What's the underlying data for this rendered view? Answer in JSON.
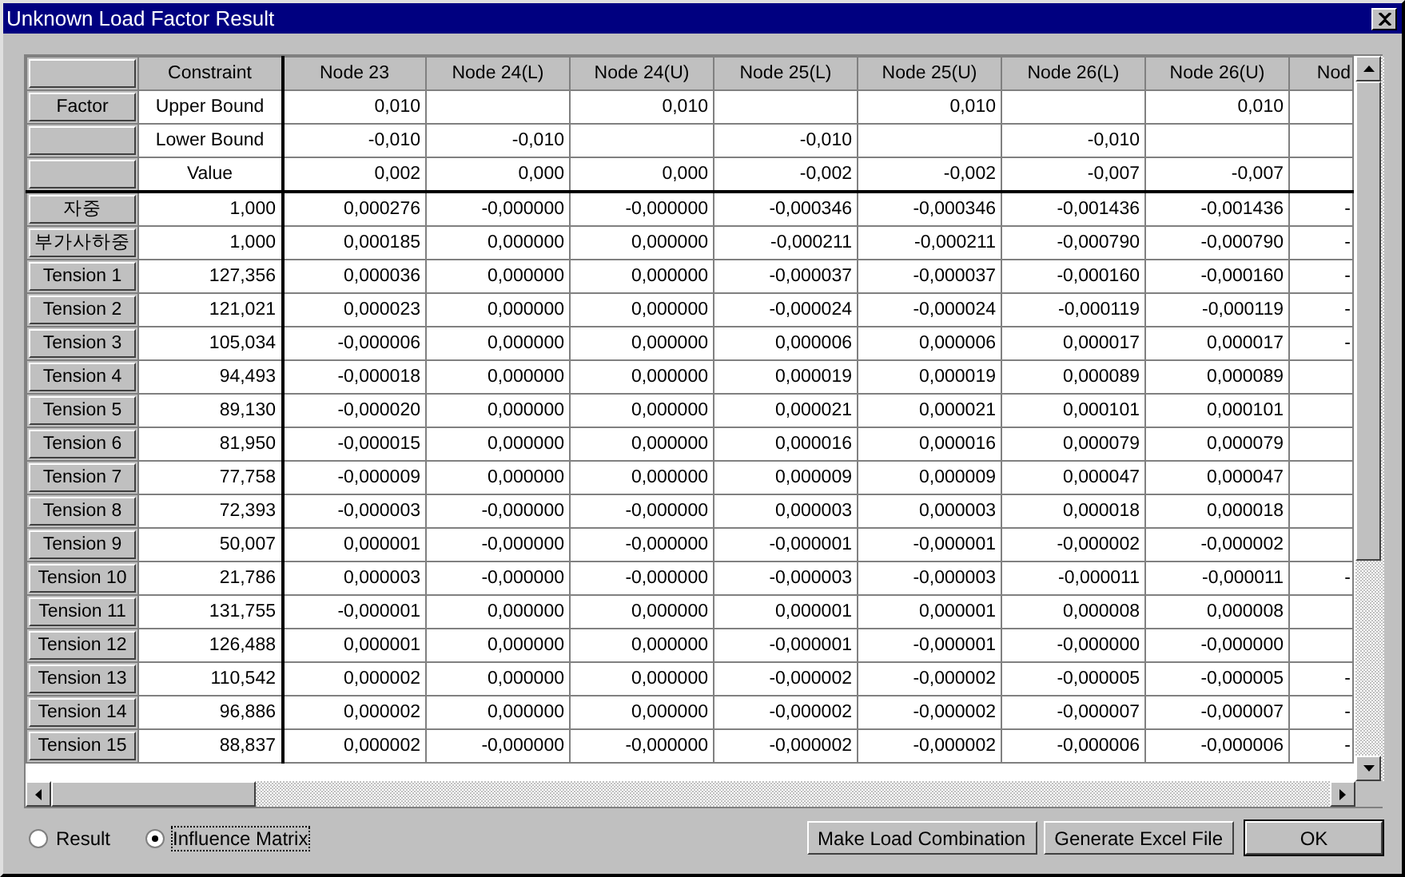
{
  "window": {
    "title": "Unknown Load Factor Result"
  },
  "table": {
    "columns": [
      "Constraint",
      "Node 23",
      "Node 24(L)",
      "Node 24(U)",
      "Node 25(L)",
      "Node 25(U)",
      "Node 26(L)",
      "Node 26(U)",
      "Nod"
    ],
    "factor_rows": [
      {
        "header": "Factor",
        "cells": [
          "Upper Bound",
          "0,010",
          null,
          "0,010",
          null,
          "0,010",
          null,
          "0,010",
          null
        ]
      },
      {
        "header": null,
        "cells": [
          "Lower Bound",
          "-0,010",
          "-0,010",
          null,
          "-0,010",
          null,
          "-0,010",
          null,
          null
        ]
      },
      {
        "header": null,
        "cells": [
          "Value",
          "0,002",
          "0,000",
          "0,000",
          "-0,002",
          "-0,002",
          "-0,007",
          "-0,007",
          null
        ]
      }
    ],
    "rows": [
      {
        "header": "자중",
        "cells": [
          "1,000",
          "0,000276",
          "-0,000000",
          "-0,000000",
          "-0,000346",
          "-0,000346",
          "-0,001436",
          "-0,001436",
          "-"
        ]
      },
      {
        "header": "부가사하중",
        "cells": [
          "1,000",
          "0,000185",
          "0,000000",
          "0,000000",
          "-0,000211",
          "-0,000211",
          "-0,000790",
          "-0,000790",
          "-"
        ]
      },
      {
        "header": "Tension 1",
        "cells": [
          "127,356",
          "0,000036",
          "0,000000",
          "0,000000",
          "-0,000037",
          "-0,000037",
          "-0,000160",
          "-0,000160",
          "-"
        ]
      },
      {
        "header": "Tension 2",
        "cells": [
          "121,021",
          "0,000023",
          "0,000000",
          "0,000000",
          "-0,000024",
          "-0,000024",
          "-0,000119",
          "-0,000119",
          "-"
        ]
      },
      {
        "header": "Tension 3",
        "cells": [
          "105,034",
          "-0,000006",
          "0,000000",
          "0,000000",
          "0,000006",
          "0,000006",
          "0,000017",
          "0,000017",
          "-"
        ]
      },
      {
        "header": "Tension 4",
        "cells": [
          "94,493",
          "-0,000018",
          "0,000000",
          "0,000000",
          "0,000019",
          "0,000019",
          "0,000089",
          "0,000089",
          null
        ]
      },
      {
        "header": "Tension 5",
        "cells": [
          "89,130",
          "-0,000020",
          "0,000000",
          "0,000000",
          "0,000021",
          "0,000021",
          "0,000101",
          "0,000101",
          null
        ]
      },
      {
        "header": "Tension 6",
        "cells": [
          "81,950",
          "-0,000015",
          "0,000000",
          "0,000000",
          "0,000016",
          "0,000016",
          "0,000079",
          "0,000079",
          null
        ]
      },
      {
        "header": "Tension 7",
        "cells": [
          "77,758",
          "-0,000009",
          "0,000000",
          "0,000000",
          "0,000009",
          "0,000009",
          "0,000047",
          "0,000047",
          null
        ]
      },
      {
        "header": "Tension 8",
        "cells": [
          "72,393",
          "-0,000003",
          "-0,000000",
          "-0,000000",
          "0,000003",
          "0,000003",
          "0,000018",
          "0,000018",
          null
        ]
      },
      {
        "header": "Tension 9",
        "cells": [
          "50,007",
          "0,000001",
          "-0,000000",
          "-0,000000",
          "-0,000001",
          "-0,000001",
          "-0,000002",
          "-0,000002",
          null
        ]
      },
      {
        "header": "Tension 10",
        "cells": [
          "21,786",
          "0,000003",
          "-0,000000",
          "-0,000000",
          "-0,000003",
          "-0,000003",
          "-0,000011",
          "-0,000011",
          "-"
        ]
      },
      {
        "header": "Tension 11",
        "cells": [
          "131,755",
          "-0,000001",
          "0,000000",
          "0,000000",
          "0,000001",
          "0,000001",
          "0,000008",
          "0,000008",
          null
        ]
      },
      {
        "header": "Tension 12",
        "cells": [
          "126,488",
          "0,000001",
          "0,000000",
          "0,000000",
          "-0,000001",
          "-0,000001",
          "-0,000000",
          "-0,000000",
          null
        ]
      },
      {
        "header": "Tension 13",
        "cells": [
          "110,542",
          "0,000002",
          "0,000000",
          "0,000000",
          "-0,000002",
          "-0,000002",
          "-0,000005",
          "-0,000005",
          "-"
        ]
      },
      {
        "header": "Tension 14",
        "cells": [
          "96,886",
          "0,000002",
          "0,000000",
          "0,000000",
          "-0,000002",
          "-0,000002",
          "-0,000007",
          "-0,000007",
          "-"
        ]
      },
      {
        "header": "Tension 15",
        "cells": [
          "88,837",
          "0,000002",
          "-0,000000",
          "-0,000000",
          "-0,000002",
          "-0,000002",
          "-0,000006",
          "-0,000006",
          "-"
        ]
      }
    ]
  },
  "options": [
    {
      "label": "Result",
      "selected": false
    },
    {
      "label": "Influence Matrix",
      "selected": true
    }
  ],
  "buttons": [
    {
      "label": "Make Load Combination",
      "default": false
    },
    {
      "label": "Generate Excel File",
      "default": false
    },
    {
      "label": "OK",
      "default": true
    }
  ]
}
